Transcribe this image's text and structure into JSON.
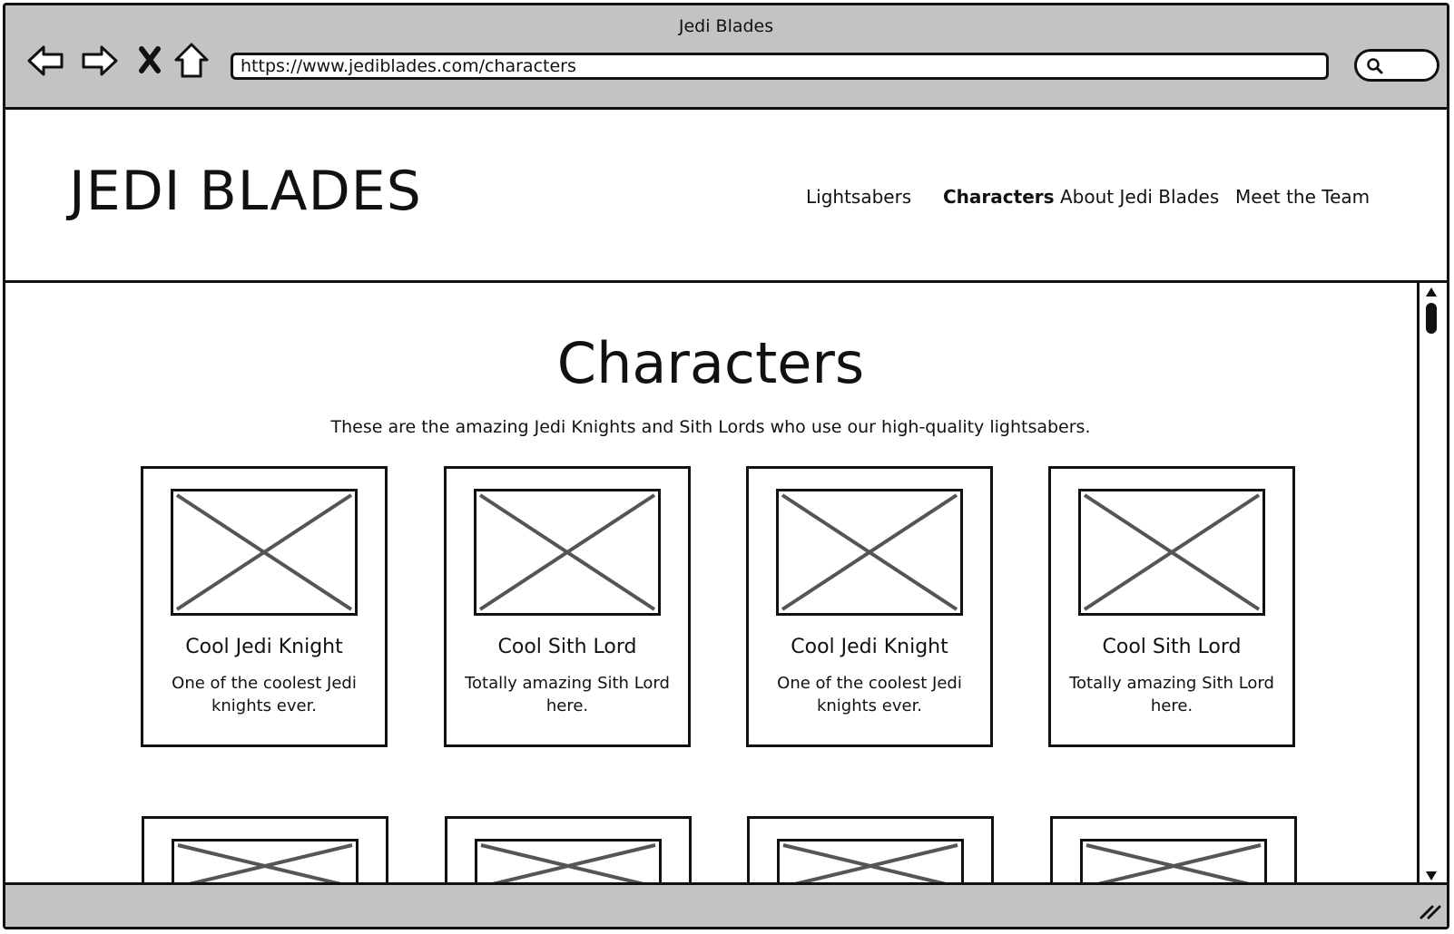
{
  "window": {
    "title": "Jedi Blades",
    "url": "https://www.jediblades.com/characters"
  },
  "toolbar": {
    "icons": [
      "back-arrow-icon",
      "forward-arrow-icon",
      "close-x-icon",
      "home-icon",
      "search-icon"
    ]
  },
  "site": {
    "logo": "JEDI BLADES",
    "nav": [
      {
        "label": "Lightsabers",
        "active": false
      },
      {
        "label": "Characters",
        "active": true
      },
      {
        "label": "About Jedi Blades",
        "active": false
      },
      {
        "label": "Meet the Team",
        "active": false
      }
    ]
  },
  "page": {
    "title": "Characters",
    "subtitle": "These are the amazing Jedi Knights and Sith Lords who use our high-quality lightsabers."
  },
  "cards": [
    {
      "name": "Cool Jedi Knight",
      "description": "One of the coolest Jedi knights ever."
    },
    {
      "name": "Cool Sith Lord",
      "description": "Totally amazing Sith Lord here."
    },
    {
      "name": "Cool Jedi Knight",
      "description": "One of the coolest Jedi knights ever."
    },
    {
      "name": "Cool Sith Lord",
      "description": "Totally amazing Sith Lord here."
    }
  ],
  "colors": {
    "chrome": "#c3c3c3",
    "ink": "#111111",
    "placeholder_x": "#555555"
  }
}
